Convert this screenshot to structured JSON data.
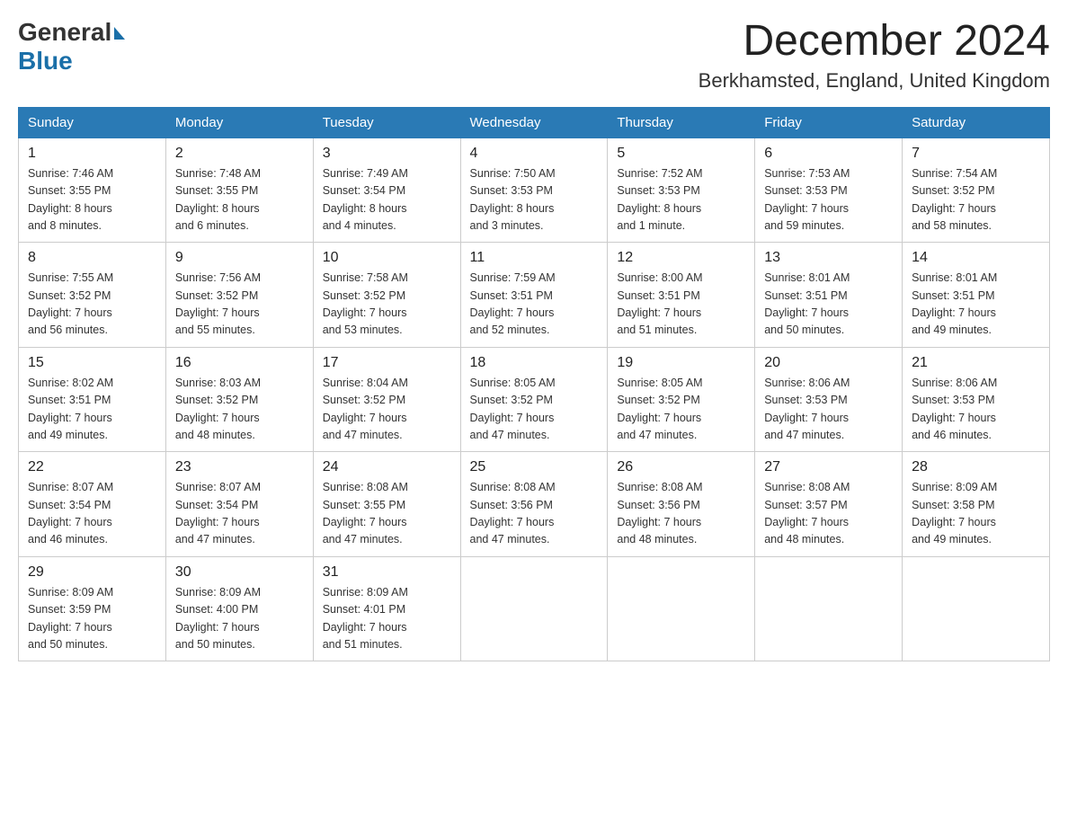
{
  "logo": {
    "general": "General",
    "blue": "Blue"
  },
  "title": {
    "month": "December 2024",
    "location": "Berkhamsted, England, United Kingdom"
  },
  "days_of_week": [
    "Sunday",
    "Monday",
    "Tuesday",
    "Wednesday",
    "Thursday",
    "Friday",
    "Saturday"
  ],
  "weeks": [
    [
      {
        "day": "1",
        "info": "Sunrise: 7:46 AM\nSunset: 3:55 PM\nDaylight: 8 hours\nand 8 minutes."
      },
      {
        "day": "2",
        "info": "Sunrise: 7:48 AM\nSunset: 3:55 PM\nDaylight: 8 hours\nand 6 minutes."
      },
      {
        "day": "3",
        "info": "Sunrise: 7:49 AM\nSunset: 3:54 PM\nDaylight: 8 hours\nand 4 minutes."
      },
      {
        "day": "4",
        "info": "Sunrise: 7:50 AM\nSunset: 3:53 PM\nDaylight: 8 hours\nand 3 minutes."
      },
      {
        "day": "5",
        "info": "Sunrise: 7:52 AM\nSunset: 3:53 PM\nDaylight: 8 hours\nand 1 minute."
      },
      {
        "day": "6",
        "info": "Sunrise: 7:53 AM\nSunset: 3:53 PM\nDaylight: 7 hours\nand 59 minutes."
      },
      {
        "day": "7",
        "info": "Sunrise: 7:54 AM\nSunset: 3:52 PM\nDaylight: 7 hours\nand 58 minutes."
      }
    ],
    [
      {
        "day": "8",
        "info": "Sunrise: 7:55 AM\nSunset: 3:52 PM\nDaylight: 7 hours\nand 56 minutes."
      },
      {
        "day": "9",
        "info": "Sunrise: 7:56 AM\nSunset: 3:52 PM\nDaylight: 7 hours\nand 55 minutes."
      },
      {
        "day": "10",
        "info": "Sunrise: 7:58 AM\nSunset: 3:52 PM\nDaylight: 7 hours\nand 53 minutes."
      },
      {
        "day": "11",
        "info": "Sunrise: 7:59 AM\nSunset: 3:51 PM\nDaylight: 7 hours\nand 52 minutes."
      },
      {
        "day": "12",
        "info": "Sunrise: 8:00 AM\nSunset: 3:51 PM\nDaylight: 7 hours\nand 51 minutes."
      },
      {
        "day": "13",
        "info": "Sunrise: 8:01 AM\nSunset: 3:51 PM\nDaylight: 7 hours\nand 50 minutes."
      },
      {
        "day": "14",
        "info": "Sunrise: 8:01 AM\nSunset: 3:51 PM\nDaylight: 7 hours\nand 49 minutes."
      }
    ],
    [
      {
        "day": "15",
        "info": "Sunrise: 8:02 AM\nSunset: 3:51 PM\nDaylight: 7 hours\nand 49 minutes."
      },
      {
        "day": "16",
        "info": "Sunrise: 8:03 AM\nSunset: 3:52 PM\nDaylight: 7 hours\nand 48 minutes."
      },
      {
        "day": "17",
        "info": "Sunrise: 8:04 AM\nSunset: 3:52 PM\nDaylight: 7 hours\nand 47 minutes."
      },
      {
        "day": "18",
        "info": "Sunrise: 8:05 AM\nSunset: 3:52 PM\nDaylight: 7 hours\nand 47 minutes."
      },
      {
        "day": "19",
        "info": "Sunrise: 8:05 AM\nSunset: 3:52 PM\nDaylight: 7 hours\nand 47 minutes."
      },
      {
        "day": "20",
        "info": "Sunrise: 8:06 AM\nSunset: 3:53 PM\nDaylight: 7 hours\nand 47 minutes."
      },
      {
        "day": "21",
        "info": "Sunrise: 8:06 AM\nSunset: 3:53 PM\nDaylight: 7 hours\nand 46 minutes."
      }
    ],
    [
      {
        "day": "22",
        "info": "Sunrise: 8:07 AM\nSunset: 3:54 PM\nDaylight: 7 hours\nand 46 minutes."
      },
      {
        "day": "23",
        "info": "Sunrise: 8:07 AM\nSunset: 3:54 PM\nDaylight: 7 hours\nand 47 minutes."
      },
      {
        "day": "24",
        "info": "Sunrise: 8:08 AM\nSunset: 3:55 PM\nDaylight: 7 hours\nand 47 minutes."
      },
      {
        "day": "25",
        "info": "Sunrise: 8:08 AM\nSunset: 3:56 PM\nDaylight: 7 hours\nand 47 minutes."
      },
      {
        "day": "26",
        "info": "Sunrise: 8:08 AM\nSunset: 3:56 PM\nDaylight: 7 hours\nand 48 minutes."
      },
      {
        "day": "27",
        "info": "Sunrise: 8:08 AM\nSunset: 3:57 PM\nDaylight: 7 hours\nand 48 minutes."
      },
      {
        "day": "28",
        "info": "Sunrise: 8:09 AM\nSunset: 3:58 PM\nDaylight: 7 hours\nand 49 minutes."
      }
    ],
    [
      {
        "day": "29",
        "info": "Sunrise: 8:09 AM\nSunset: 3:59 PM\nDaylight: 7 hours\nand 50 minutes."
      },
      {
        "day": "30",
        "info": "Sunrise: 8:09 AM\nSunset: 4:00 PM\nDaylight: 7 hours\nand 50 minutes."
      },
      {
        "day": "31",
        "info": "Sunrise: 8:09 AM\nSunset: 4:01 PM\nDaylight: 7 hours\nand 51 minutes."
      },
      {
        "day": "",
        "info": ""
      },
      {
        "day": "",
        "info": ""
      },
      {
        "day": "",
        "info": ""
      },
      {
        "day": "",
        "info": ""
      }
    ]
  ]
}
